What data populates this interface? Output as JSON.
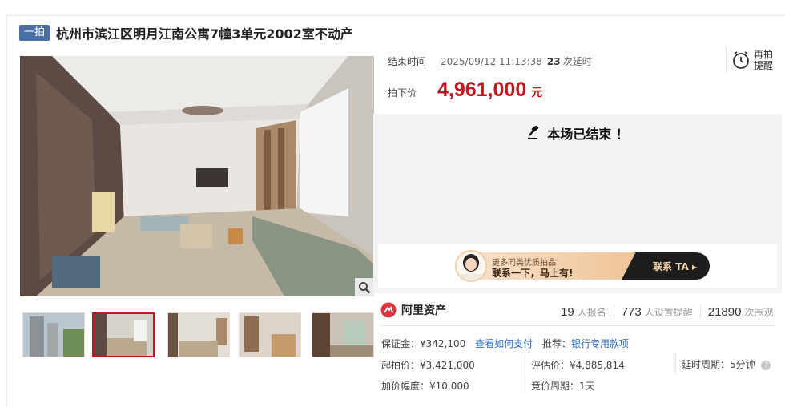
{
  "listing": {
    "round_tag": "一拍",
    "title": "杭州市滨江区明月江南公寓7幢3单元2002室不动产"
  },
  "auction": {
    "end_label": "结束时间",
    "end_time": "2025/09/12 11:13:38",
    "delay_count": "23",
    "delay_text": "次延时",
    "remind_line1": "再拍",
    "remind_line2": "提醒",
    "price_label": "拍下价",
    "price": "4,961,000",
    "price_unit": "元",
    "ended_text": "本场已结束 ！"
  },
  "banner": {
    "subtitle": "更多同类优质拍品",
    "main": "联系一下，马上有!",
    "cta": "联系 TA"
  },
  "brand": {
    "name": "阿里资产"
  },
  "stats": [
    {
      "num": "19",
      "text": "人报名"
    },
    {
      "num": "773",
      "text": "人设置提醒"
    },
    {
      "num": "21890",
      "text": "次围观"
    }
  ],
  "details": {
    "deposit": "保证金：¥342,100",
    "how_to_pay": "查看如何支付",
    "recommend_label": "推荐：",
    "recommend_link": "银行专用款项",
    "start_price": "起拍价：¥3,421,000",
    "assess_price": "评估价：¥4,885,814",
    "delay_period": "延时周期：5分钟",
    "increment": "加价幅度：¥10,000",
    "bid_period": "竞价周期：1天"
  },
  "colors": {
    "price_red": "#c4161c",
    "tag_blue": "#4a6fa5",
    "link_blue": "#2b6cc4"
  },
  "icons": [
    "gavel-icon",
    "alarm-clock-icon",
    "zoom-icon",
    "ali-asset-logo-icon",
    "help-icon",
    "play-arrow-icon"
  ]
}
